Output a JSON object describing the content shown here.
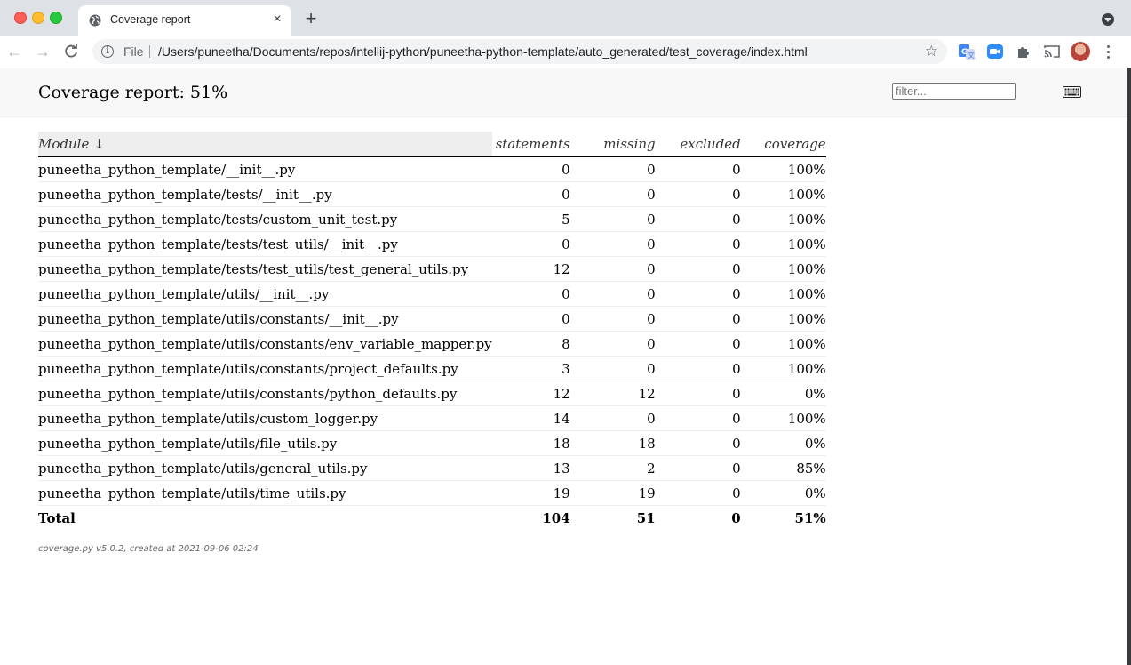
{
  "browser": {
    "tab_title": "Coverage report",
    "file_label": "File",
    "url": "/Users/puneetha/Documents/repos/intellij-python/puneetha-python-template/auto_generated/test_coverage/index.html"
  },
  "report": {
    "title": "Coverage report: 51%",
    "filter_placeholder": "filter...",
    "columns": [
      "Module ↓",
      "statements",
      "missing",
      "excluded",
      "coverage"
    ],
    "rows": [
      {
        "module": "puneetha_python_template/__init__.py",
        "statements": "0",
        "missing": "0",
        "excluded": "0",
        "coverage": "100%"
      },
      {
        "module": "puneetha_python_template/tests/__init__.py",
        "statements": "0",
        "missing": "0",
        "excluded": "0",
        "coverage": "100%"
      },
      {
        "module": "puneetha_python_template/tests/custom_unit_test.py",
        "statements": "5",
        "missing": "0",
        "excluded": "0",
        "coverage": "100%"
      },
      {
        "module": "puneetha_python_template/tests/test_utils/__init__.py",
        "statements": "0",
        "missing": "0",
        "excluded": "0",
        "coverage": "100%"
      },
      {
        "module": "puneetha_python_template/tests/test_utils/test_general_utils.py",
        "statements": "12",
        "missing": "0",
        "excluded": "0",
        "coverage": "100%"
      },
      {
        "module": "puneetha_python_template/utils/__init__.py",
        "statements": "0",
        "missing": "0",
        "excluded": "0",
        "coverage": "100%"
      },
      {
        "module": "puneetha_python_template/utils/constants/__init__.py",
        "statements": "0",
        "missing": "0",
        "excluded": "0",
        "coverage": "100%"
      },
      {
        "module": "puneetha_python_template/utils/constants/env_variable_mapper.py",
        "statements": "8",
        "missing": "0",
        "excluded": "0",
        "coverage": "100%"
      },
      {
        "module": "puneetha_python_template/utils/constants/project_defaults.py",
        "statements": "3",
        "missing": "0",
        "excluded": "0",
        "coverage": "100%"
      },
      {
        "module": "puneetha_python_template/utils/constants/python_defaults.py",
        "statements": "12",
        "missing": "12",
        "excluded": "0",
        "coverage": "0%"
      },
      {
        "module": "puneetha_python_template/utils/custom_logger.py",
        "statements": "14",
        "missing": "0",
        "excluded": "0",
        "coverage": "100%"
      },
      {
        "module": "puneetha_python_template/utils/file_utils.py",
        "statements": "18",
        "missing": "18",
        "excluded": "0",
        "coverage": "0%"
      },
      {
        "module": "puneetha_python_template/utils/general_utils.py",
        "statements": "13",
        "missing": "2",
        "excluded": "0",
        "coverage": "85%"
      },
      {
        "module": "puneetha_python_template/utils/time_utils.py",
        "statements": "19",
        "missing": "19",
        "excluded": "0",
        "coverage": "0%"
      }
    ],
    "total": {
      "label": "Total",
      "statements": "104",
      "missing": "51",
      "excluded": "0",
      "coverage": "51%"
    },
    "footer": "coverage.py v5.0.2, created at 2021-09-06 02:24"
  }
}
